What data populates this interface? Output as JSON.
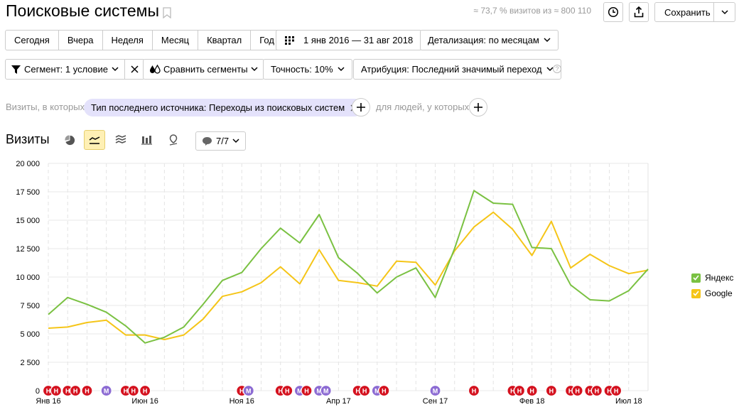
{
  "header": {
    "title": "Поисковые системы",
    "visits_info": "≈ 73,7 % визитов из ≈ 800 110",
    "save_label": "Сохранить"
  },
  "periods": [
    "Сегодня",
    "Вчера",
    "Неделя",
    "Месяц",
    "Квартал",
    "Год"
  ],
  "date_range": "1 янв 2016 — 31 авг 2018",
  "detail": "Детализация: по месяцам",
  "filters": {
    "segment": "Сегмент: 1 условие",
    "compare": "Сравнить сегменты",
    "accuracy": "Точность: 10%",
    "attribution": "Атрибуция: Последний значимый переход",
    "help": "?"
  },
  "condition": {
    "visits_prefix": "Визиты, в которых",
    "pill": "Тип последнего источника: Переходы из поисковых систем",
    "people": "для людей, у которых"
  },
  "chart_section": {
    "title": "Визиты",
    "annotations_count": "7/7"
  },
  "colors": {
    "yandex": "#7ac142",
    "google": "#f5c518",
    "accent_pill": "#e4e2fb",
    "marker_red": "#d4121f",
    "marker_purple": "#8c6bd3"
  },
  "chart_data": {
    "type": "line",
    "ylim": [
      0,
      20000
    ],
    "y_ticks": [
      "0",
      "2 500",
      "5 000",
      "7 500",
      "10 000",
      "12 500",
      "15 000",
      "17 500",
      "20 000"
    ],
    "x_tick_labels": [
      {
        "label": "Янв 16",
        "index": 0
      },
      {
        "label": "Июн 16",
        "index": 5
      },
      {
        "label": "Ноя 16",
        "index": 10
      },
      {
        "label": "Апр 17",
        "index": 15
      },
      {
        "label": "Сен 17",
        "index": 20
      },
      {
        "label": "Фев 18",
        "index": 25
      },
      {
        "label": "Июл 18",
        "index": 30
      }
    ],
    "x": [
      "2016-01",
      "2016-02",
      "2016-03",
      "2016-04",
      "2016-05",
      "2016-06",
      "2016-07",
      "2016-08",
      "2016-09",
      "2016-10",
      "2016-11",
      "2016-12",
      "2017-01",
      "2017-02",
      "2017-03",
      "2017-04",
      "2017-05",
      "2017-06",
      "2017-07",
      "2017-08",
      "2017-09",
      "2017-10",
      "2017-11",
      "2017-12",
      "2018-01",
      "2018-02",
      "2018-03",
      "2018-04",
      "2018-05",
      "2018-06",
      "2018-07",
      "2018-08"
    ],
    "series": [
      {
        "name": "Яндекс",
        "color": "#7ac142",
        "values": [
          6700,
          8200,
          7600,
          6900,
          5700,
          4200,
          4700,
          5600,
          7600,
          9700,
          10400,
          12500,
          14300,
          13000,
          15500,
          11700,
          10300,
          8600,
          10000,
          10800,
          8200,
          12500,
          17600,
          16500,
          16400,
          12600,
          12500,
          9300,
          8000,
          7900,
          8800,
          10700
        ]
      },
      {
        "name": "Google",
        "color": "#f5c518",
        "values": [
          5500,
          5600,
          6000,
          6200,
          4900,
          4900,
          4500,
          4900,
          6300,
          8300,
          8700,
          9500,
          10900,
          9400,
          12400,
          9700,
          9500,
          9200,
          11400,
          11300,
          9300,
          12300,
          14400,
          15700,
          14200,
          11900,
          14900,
          10800,
          12000,
          11000,
          10300,
          10600
        ]
      }
    ],
    "legend": [
      "Яндекс",
      "Google"
    ],
    "grid": true,
    "legend_position": "right",
    "markers": [
      {
        "i": 0,
        "t": "Н"
      },
      {
        "i": 0.4,
        "t": "Н"
      },
      {
        "i": 1,
        "t": "Н"
      },
      {
        "i": 1.4,
        "t": "Н"
      },
      {
        "i": 2,
        "t": "Н"
      },
      {
        "i": 3,
        "t": "М"
      },
      {
        "i": 4,
        "t": "Н"
      },
      {
        "i": 4.4,
        "t": "Н"
      },
      {
        "i": 5,
        "t": "Н"
      },
      {
        "i": 10,
        "t": "Н"
      },
      {
        "i": 10.35,
        "t": "М"
      },
      {
        "i": 12,
        "t": "Н"
      },
      {
        "i": 12.35,
        "t": "Н"
      },
      {
        "i": 13,
        "t": "М"
      },
      {
        "i": 13.35,
        "t": "Н"
      },
      {
        "i": 14,
        "t": "М"
      },
      {
        "i": 14.35,
        "t": "М"
      },
      {
        "i": 16,
        "t": "Н"
      },
      {
        "i": 16.35,
        "t": "Н"
      },
      {
        "i": 17,
        "t": "М"
      },
      {
        "i": 17.35,
        "t": "Н"
      },
      {
        "i": 20,
        "t": "М"
      },
      {
        "i": 22,
        "t": "Н"
      },
      {
        "i": 24,
        "t": "Н"
      },
      {
        "i": 24.35,
        "t": "Н"
      },
      {
        "i": 25,
        "t": "Н"
      },
      {
        "i": 26,
        "t": "Н"
      },
      {
        "i": 27,
        "t": "Н"
      },
      {
        "i": 27.35,
        "t": "Н"
      },
      {
        "i": 28,
        "t": "Н"
      },
      {
        "i": 28.35,
        "t": "Н"
      },
      {
        "i": 29,
        "t": "Н"
      },
      {
        "i": 29.35,
        "t": "Н"
      }
    ]
  }
}
